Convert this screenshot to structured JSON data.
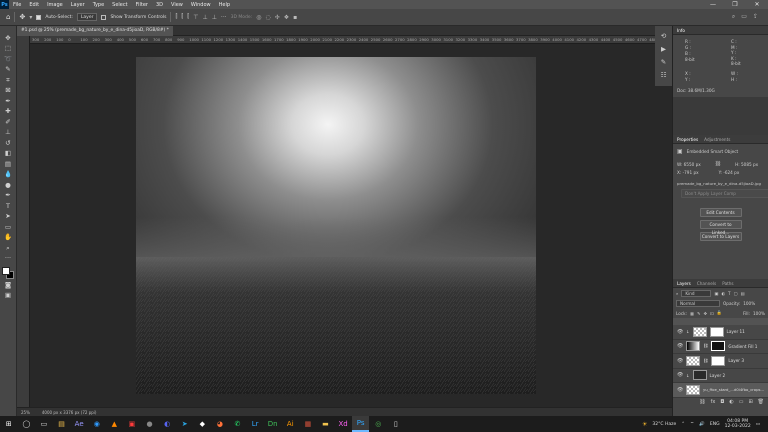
{
  "app": {
    "logo": "Ps"
  },
  "menu": [
    "File",
    "Edit",
    "Image",
    "Layer",
    "Type",
    "Select",
    "Filter",
    "3D",
    "View",
    "Window",
    "Help"
  ],
  "window_controls": [
    "—",
    "❐",
    "✕"
  ],
  "options": {
    "auto_select_label": "Auto-Select:",
    "auto_select_value": "Layer",
    "transform_label": "Show Transform Controls",
    "mode_label": "3D Mode:"
  },
  "document": {
    "tab_title": "#1.psd @ 25% (premade_bg_nature_by_e_dina-d5jioaD, RGB/8#) *",
    "zoom": "25%",
    "doc_size": "4000 px x 3376 px (72 ppi)"
  },
  "ruler": [
    "300",
    "200",
    "100",
    "0",
    "100",
    "200",
    "300",
    "400",
    "500",
    "600",
    "700",
    "800",
    "900",
    "1000",
    "1100",
    "1200",
    "1300",
    "1400",
    "1500",
    "1600",
    "1700",
    "1800",
    "1900",
    "2000",
    "2100",
    "2200",
    "2300",
    "2400",
    "2500",
    "2600",
    "2700",
    "2800",
    "2900",
    "3000",
    "3100",
    "3200",
    "3300",
    "3400",
    "3500",
    "3600",
    "3700",
    "3800",
    "3900",
    "4000",
    "4100",
    "4200",
    "4300",
    "4400",
    "4500",
    "4600",
    "4700",
    "4800",
    "4900",
    "5000"
  ],
  "info_panel": {
    "title": "Info",
    "r": "R :",
    "g": "G :",
    "b": "B :",
    "c": "C :",
    "m": "M :",
    "y": "Y :",
    "k": "K :",
    "bit_left": "8-bit",
    "bit_right": "8-bit",
    "x": "X :",
    "y_coord": "Y :",
    "w": "W :",
    "h": "H :",
    "doc": "Doc: 38.6M/1.30G"
  },
  "properties": {
    "tab_active": "Properties",
    "tab_other": "Adjustments",
    "object_type": "Embedded Smart Object",
    "w": "W: 6550 px",
    "h": "H: 5085 px",
    "x": "X: -791 px",
    "y": "Y: -624 px",
    "filename": "premade_bg_nature_by_e_dina-d5jioaD.jpg",
    "layer_comp": "Don't Apply Layer Comp",
    "buttons": [
      "Edit Contents",
      "Convert to Linked...",
      "Convert to Layers"
    ]
  },
  "layers": {
    "tabs": [
      "Layers",
      "Channels",
      "Paths"
    ],
    "filter": "Kind",
    "blend": "Normal",
    "opacity_label": "Opacity:",
    "opacity": "100%",
    "lock_label": "Lock:",
    "fill_label": "Fill:",
    "fill": "100%",
    "items": [
      {
        "name": "Layer 11"
      },
      {
        "name": "Gradient Fill 1"
      },
      {
        "name": "Layer 3"
      },
      {
        "name": "Layer 2"
      },
      {
        "name": "yu_ffoe_stard_...d0i4fbo_crops..."
      }
    ]
  },
  "taskbar": {
    "weather": "32°C  Haze",
    "lang": "ENG",
    "time": "04:08 PM",
    "date": "12-03-2022",
    "apps": [
      {
        "icon": "⊞",
        "color": "#ffffff"
      },
      {
        "icon": "◯",
        "color": "#dddddd"
      },
      {
        "icon": "▭",
        "color": "#dddddd"
      },
      {
        "icon": "▤",
        "color": "#f2c14e"
      },
      {
        "icon": "Ae",
        "color": "#9999ff"
      },
      {
        "icon": "◉",
        "color": "#2f9bff"
      },
      {
        "icon": "▲",
        "color": "#ff8800"
      },
      {
        "icon": "▣",
        "color": "#ff3b3b"
      },
      {
        "icon": "●",
        "color": "#888888"
      },
      {
        "icon": "◐",
        "color": "#5865f2"
      },
      {
        "icon": "➤",
        "color": "#2aa3e0"
      },
      {
        "icon": "◆",
        "color": "#ffffff"
      },
      {
        "icon": "◕",
        "color": "#ff7139"
      },
      {
        "icon": "✆",
        "color": "#25d366"
      },
      {
        "icon": "Lr",
        "color": "#31a8ff"
      },
      {
        "icon": "Dn",
        "color": "#3fbf5a"
      },
      {
        "icon": "Ai",
        "color": "#ff9a00"
      },
      {
        "icon": "▦",
        "color": "#d6533c"
      },
      {
        "icon": "▬",
        "color": "#f0c24e"
      },
      {
        "icon": "Xd",
        "color": "#ff61f6"
      },
      {
        "icon": "Ps",
        "color": "#31a8ff"
      },
      {
        "icon": "◎",
        "color": "#4caf50"
      },
      {
        "icon": "▯",
        "color": "#dddddd"
      }
    ]
  }
}
